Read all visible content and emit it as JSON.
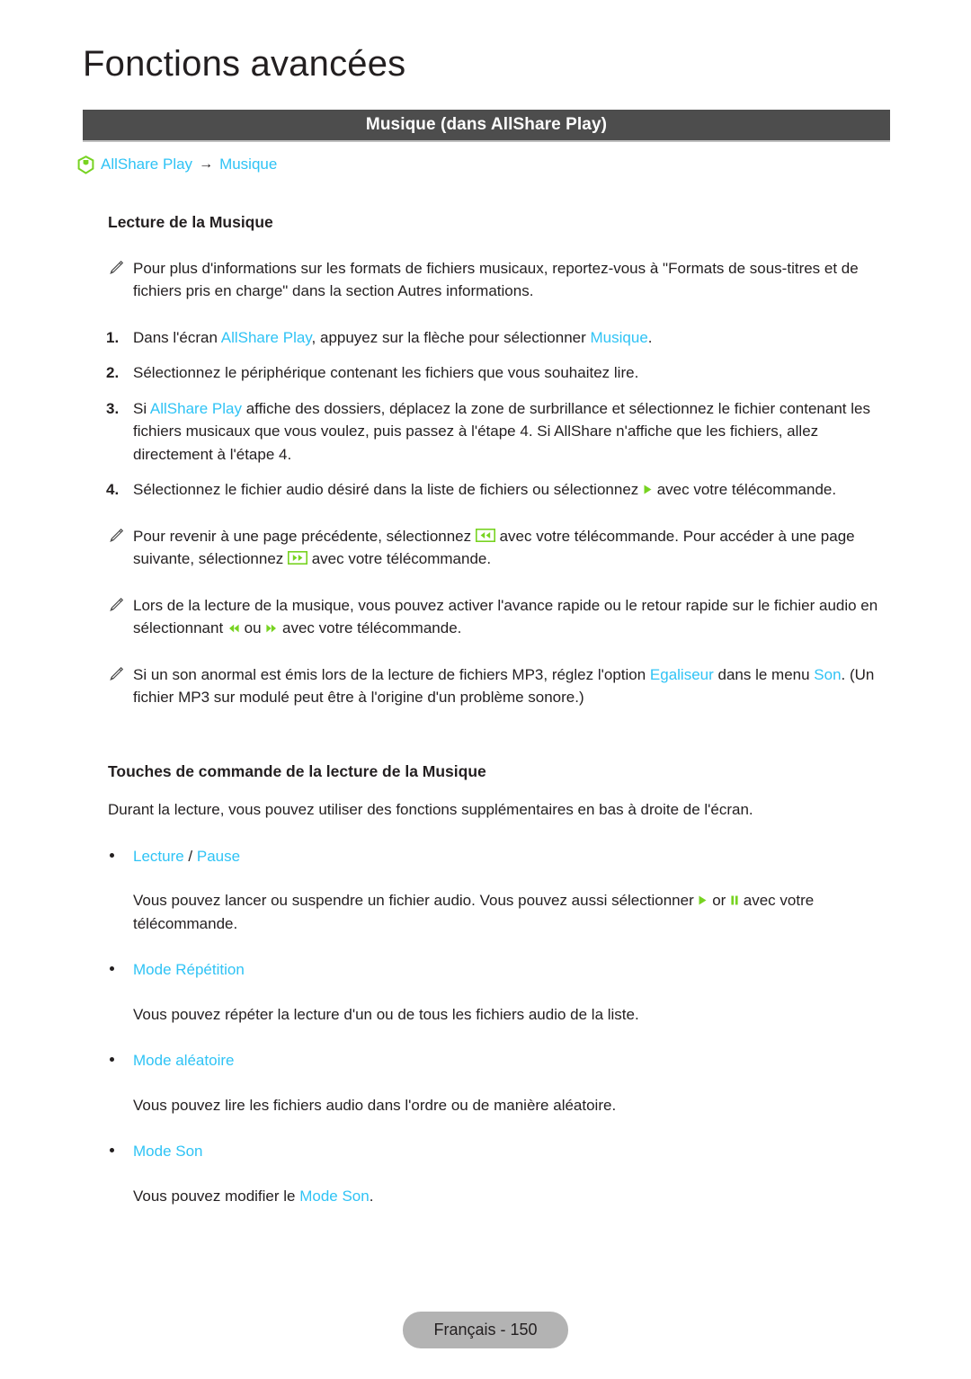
{
  "chapter": {
    "title": "Fonctions avancées"
  },
  "section": {
    "title": "Musique (dans AllShare Play)"
  },
  "breadcrumb": {
    "hub_icon": "smart-hub-icon",
    "arrow": "→",
    "items": [
      {
        "label": "AllShare Play"
      },
      {
        "label": "Musique"
      }
    ]
  },
  "main": {
    "heading_playback": "Lecture de la Musique",
    "note_formats": {
      "icon": "pencil-icon",
      "text": "Pour plus d'informations sur les formats de fichiers musicaux, reportez-vous à \"Formats de sous-titres et de fichiers  pris en charge\" dans la section Autres informations."
    },
    "steps": [
      {
        "num": "1.",
        "pre": "Dans l'écran ",
        "hl1": "AllShare Play",
        "mid": ", appuyez sur la flèche pour sélectionner ",
        "hl2": "Musique",
        "post": "."
      },
      {
        "num": "2.",
        "pre": "Sélectionnez le périphérique contenant les fichiers que vous souhaitez lire.",
        "hl1": "",
        "mid": "",
        "hl2": "",
        "post": ""
      },
      {
        "num": "3.",
        "pre": "Si ",
        "hl1": "AllShare Play",
        "mid": " affiche des dossiers, déplacez la zone de surbrillance et sélectionnez le fichier contenant les fichiers musicaux que vous voulez, puis passez à l'étape 4. Si AllShare n'affiche que les fichiers, allez directement à l'étape 4.",
        "hl2": "",
        "post": ""
      },
      {
        "num": "4.",
        "pre": "Sélectionnez le fichier audio désiré dans la liste de fichiers ou sélectionnez ",
        "icon": "play-icon",
        "post": " avec votre télécommande."
      }
    ],
    "note_pages": {
      "icon": "pencil-icon",
      "pre": "Pour revenir à une page précédente, sélectionnez ",
      "icon1": "rewind-button-icon",
      "mid": " avec votre télécommande. Pour accéder à une page suivante, sélectionnez ",
      "icon2": "fast-forward-button-icon",
      "post": " avec votre télécommande."
    },
    "note_seek": {
      "icon": "pencil-icon",
      "pre": "Lors de la lecture de la musique, vous pouvez activer l'avance rapide ou le retour rapide sur le fichier audio en sélectionnant ",
      "icon1": "rewind-icon",
      "mid": " ou ",
      "icon2": "fast-forward-icon",
      "post": " avec votre télécommande."
    },
    "note_equalizer": {
      "icon": "pencil-icon",
      "pre": "Si un son anormal est émis lors de la lecture de fichiers MP3, réglez l'option ",
      "hl1": "Egaliseur",
      "mid": " dans le menu ",
      "hl2": "Son",
      "post": ". (Un fichier MP3 sur modulé peut être à l'origine d'un problème sonore.)"
    },
    "heading_controls": "Touches de commande de la lecture de la Musique",
    "controls_intro": "Durant la lecture, vous pouvez utiliser des fonctions supplémentaires en bas à droite de l'écran.",
    "bullets": [
      {
        "label": "Lecture",
        "sep": " / ",
        "label2": "Pause",
        "desc_pre": "Vous pouvez lancer ou suspendre un fichier audio. Vous pouvez aussi sélectionner ",
        "icon1": "play-icon",
        "desc_mid": " or ",
        "icon2": "pause-icon",
        "desc_post": " avec votre télécommande."
      },
      {
        "label": "Mode Répétition",
        "sep": "",
        "label2": "",
        "desc_pre": "Vous pouvez répéter la lecture d'un ou de tous les fichiers audio de la liste.",
        "icon1": "",
        "desc_mid": "",
        "icon2": "",
        "desc_post": ""
      },
      {
        "label": "Mode aléatoire",
        "sep": "",
        "label2": "",
        "desc_pre": "Vous pouvez lire les fichiers audio dans l'ordre ou de manière aléatoire.",
        "icon1": "",
        "desc_mid": "",
        "icon2": "",
        "desc_post": ""
      },
      {
        "label": "Mode Son",
        "sep": "",
        "label2": "",
        "desc_pre": "Vous pouvez modifier le ",
        "icon1": "",
        "desc_mid": "",
        "icon2": "",
        "desc_post": "."
      }
    ],
    "bullet4_highlight": "Mode Son"
  },
  "footer": {
    "page_label": "Français - 150"
  },
  "colors": {
    "highlight": "#2fc3f5",
    "accent_green": "#77d321",
    "bar_bg": "#4d4d4d",
    "badge_bg": "#b3b3b3",
    "text": "#231f20"
  }
}
